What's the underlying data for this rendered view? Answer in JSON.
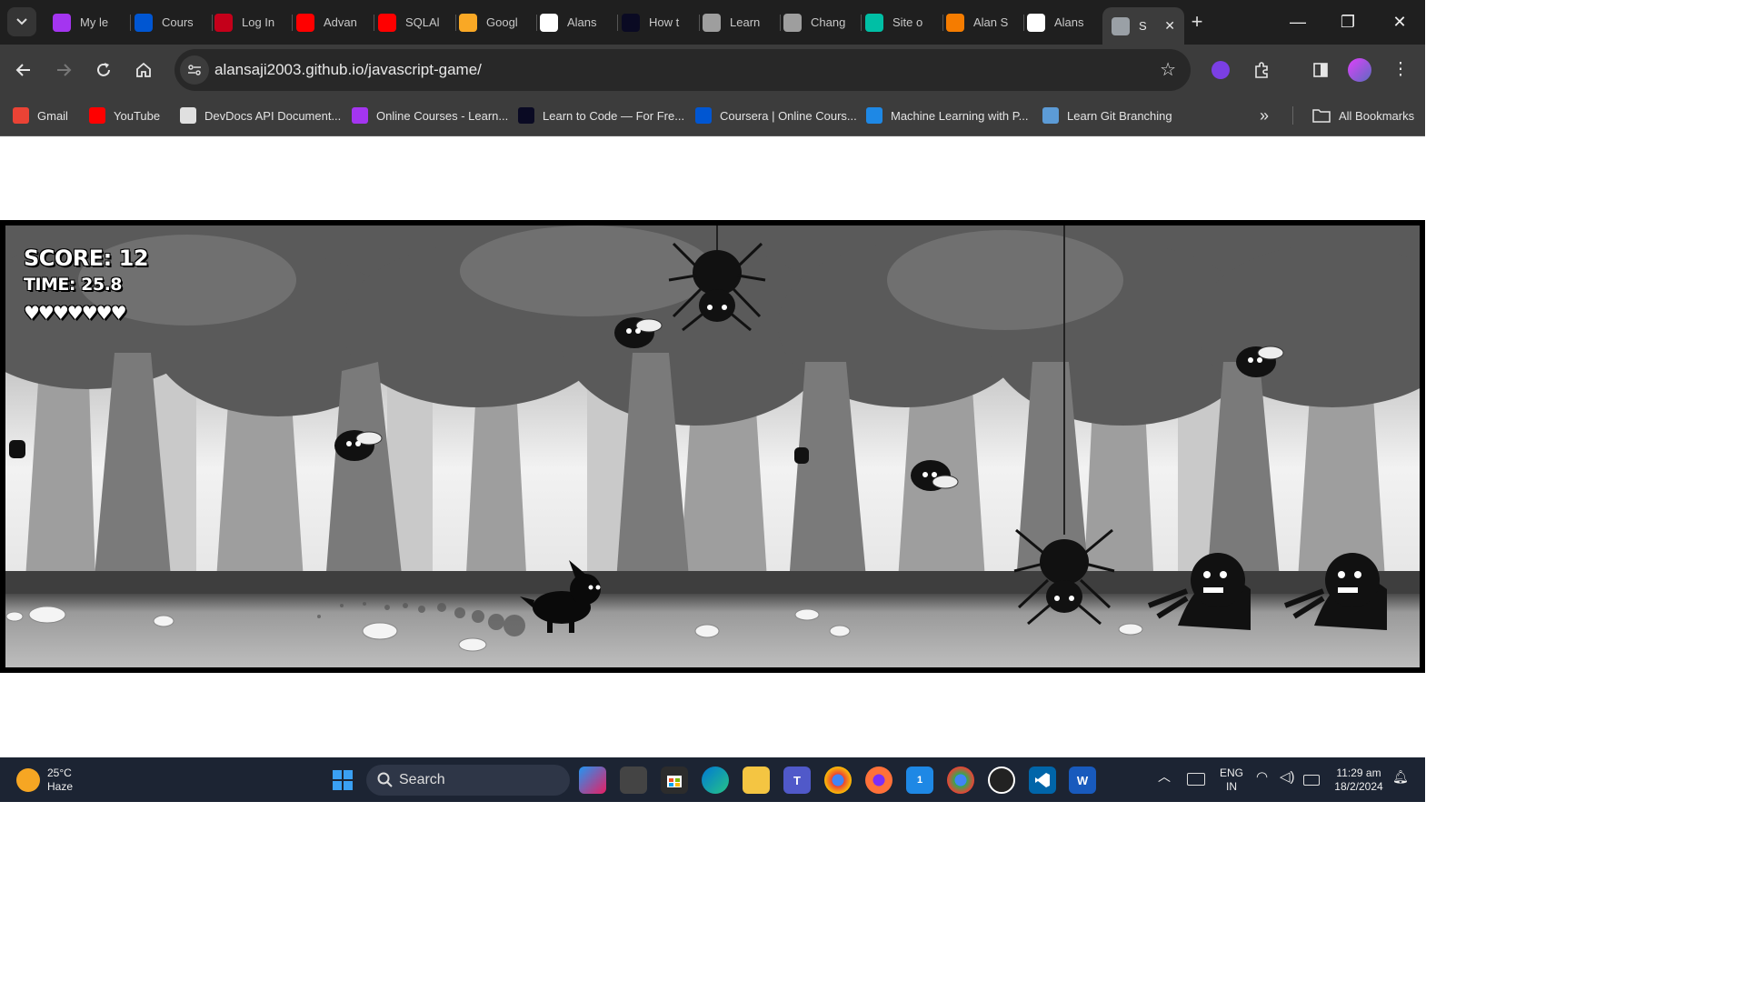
{
  "browser": {
    "tabs": [
      {
        "label": "My le",
        "icon": "udemy-icon",
        "color": "#a435f0"
      },
      {
        "label": "Cours",
        "icon": "coursera-icon",
        "color": "#0056d2"
      },
      {
        "label": "Log In",
        "icon": "codecademy-icon",
        "color": "#c4001a"
      },
      {
        "label": "Advan",
        "icon": "youtube-icon",
        "color": "#ff0000"
      },
      {
        "label": "SQLAl",
        "icon": "youtube-icon",
        "color": "#ff0000"
      },
      {
        "label": "Googl",
        "icon": "google-icon",
        "color": "#f9a825"
      },
      {
        "label": "Alans",
        "icon": "github-icon",
        "color": "#ffffff"
      },
      {
        "label": "How t",
        "icon": "freecodecamp-icon",
        "color": "#0a0a23"
      },
      {
        "label": "Learn",
        "icon": "unity-icon",
        "color": "#9e9e9e"
      },
      {
        "label": "Chang",
        "icon": "unity-icon",
        "color": "#9e9e9e"
      },
      {
        "label": "Site o",
        "icon": "diamond-icon",
        "color": "#00bfa5"
      },
      {
        "label": "Alan S",
        "icon": "as-icon",
        "color": "#f57c00"
      },
      {
        "label": "Alans",
        "icon": "github-icon",
        "color": "#ffffff"
      },
      {
        "label": "S",
        "icon": "globe-icon",
        "color": "#9aa0a6",
        "active": true
      }
    ],
    "new_tab": "+",
    "window_controls": {
      "minimize": "—",
      "restore": "❐",
      "close": "✕"
    },
    "url": "alansaji2003.github.io/javascript-game/",
    "bookmarks": [
      {
        "label": "Gmail",
        "icon": "gmail-icon",
        "color": "#ea4335"
      },
      {
        "label": "YouTube",
        "icon": "youtube-icon",
        "color": "#ff0000"
      },
      {
        "label": "DevDocs API Document...",
        "icon": "devdocs-icon",
        "color": "#e0e0e0"
      },
      {
        "label": "Online Courses - Learn...",
        "icon": "udemy-icon",
        "color": "#a435f0"
      },
      {
        "label": "Learn to Code — For Fre...",
        "icon": "freecodecamp-icon",
        "color": "#0a0a23"
      },
      {
        "label": "Coursera | Online Cours...",
        "icon": "coursera-icon",
        "color": "#0056d2"
      },
      {
        "label": "Machine Learning with P...",
        "icon": "ml-icon",
        "color": "#1e88e5"
      },
      {
        "label": "Learn Git Branching",
        "icon": "git-branching-icon",
        "color": "#5c9bd6"
      }
    ],
    "more_bookmarks": "»",
    "all_bookmarks": "All Bookmarks"
  },
  "game": {
    "score_text": "SCORE: 12",
    "time_text": "TIME: 25.8",
    "lives": 7,
    "lives_glyphs": "♥♥♥♥♥♥♥"
  },
  "taskbar": {
    "weather_temp": "25°C",
    "weather_desc": "Haze",
    "search_placeholder": "Search",
    "language_line1": "ENG",
    "language_line2": "IN",
    "time": "11:29 am",
    "date": "18/2/2024",
    "notification_badge": "1"
  }
}
